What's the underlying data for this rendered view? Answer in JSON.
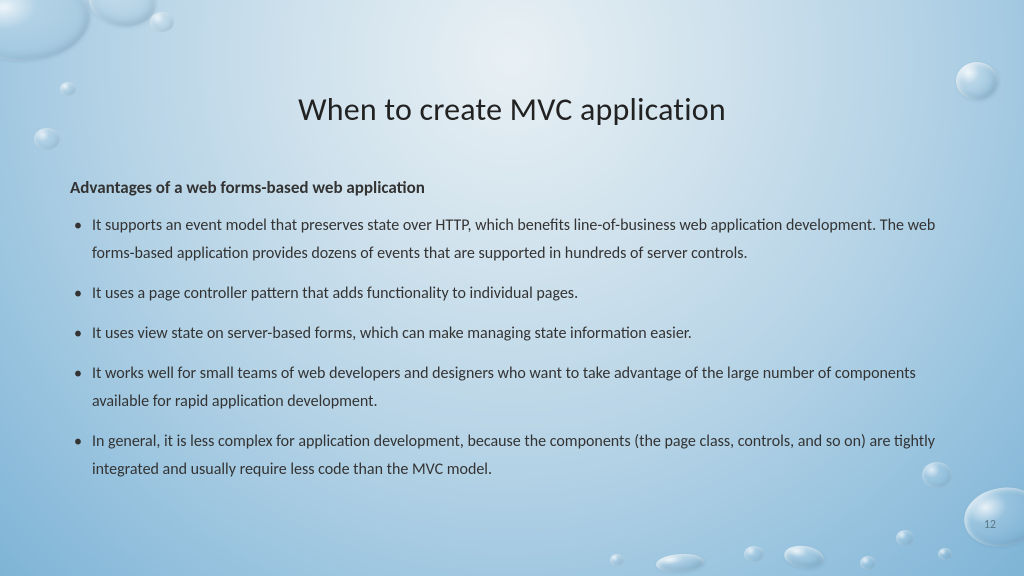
{
  "title": "When to create MVC application",
  "subheading": "Advantages of a web forms-based web application",
  "bullets": [
    "It supports an event model that preserves state over HTTP, which benefits line-of-business web application development. The web forms-based application provides dozens of events that are supported in hundreds of server controls.",
    "It uses a page controller pattern that adds functionality to individual pages.",
    "It uses view state on server-based forms, which can make managing state information easier.",
    "It works well for small teams of web developers and designers who want to take advantage of the large number of components available for rapid application development.",
    "In general, it is less complex for application development, because the components (the page class, controls, and so on) are tightly integrated and usually require less code than the MVC model."
  ],
  "page_number": "12"
}
